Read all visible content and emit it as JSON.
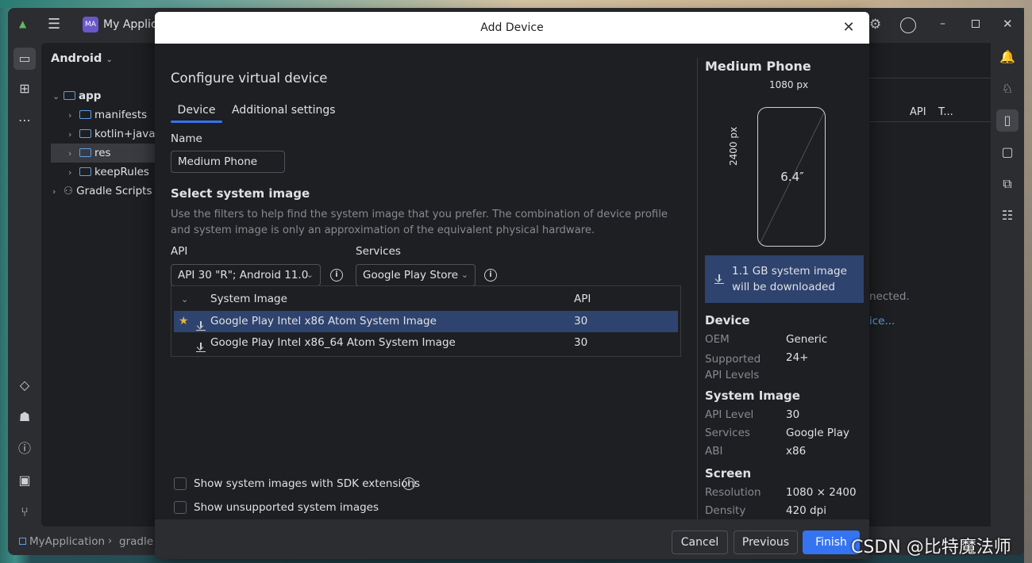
{
  "ide": {
    "app_badge": "MA",
    "app_title": "My Applica",
    "project_view": "Android",
    "tree": [
      {
        "label": "app",
        "level": 0,
        "expanded": true
      },
      {
        "label": "manifests",
        "level": 1
      },
      {
        "label": "kotlin+java",
        "level": 1
      },
      {
        "label": "res",
        "level": 1,
        "selected": true
      },
      {
        "label": "keepRules",
        "level": 1
      },
      {
        "label": "Gradle Scripts",
        "level": 0
      }
    ],
    "editor_header_cols": [
      "API",
      "T..."
    ],
    "editor_text_1": "nected.",
    "editor_text_2": "ice...",
    "breadcrumb": [
      "MyApplication",
      "gradle"
    ]
  },
  "dialog": {
    "title": "Add Device",
    "heading": "Configure virtual device",
    "tabs": [
      {
        "label": "Device",
        "active": true
      },
      {
        "label": "Additional settings",
        "active": false
      }
    ],
    "name_label": "Name",
    "name_value": "Medium Phone",
    "system_image_heading": "Select system image",
    "help_text": "Use the filters to help find the system image that you prefer. The combination of device profile and system image is only an approximation of the equivalent physical hardware.",
    "api_label": "API",
    "api_value": "API 30 \"R\"; Android 11.0",
    "services_label": "Services",
    "services_value": "Google Play Store",
    "table": {
      "columns": [
        "System Image",
        "API"
      ],
      "rows": [
        {
          "name": "Google Play Intel x86 Atom System Image",
          "api": "30",
          "selected": true,
          "starred": true
        },
        {
          "name": "Google Play Intel x86_64 Atom System Image",
          "api": "30",
          "selected": false,
          "starred": false
        }
      ]
    },
    "checkbox_sdk": "Show system images with SDK extensions",
    "checkbox_unsupported": "Show unsupported system images",
    "buttons": {
      "cancel": "Cancel",
      "previous": "Previous",
      "finish": "Finish"
    }
  },
  "side": {
    "title": "Medium Phone",
    "width_px": "1080 px",
    "height_px": "2400 px",
    "diagonal": "6.4″",
    "download_note": "1.1 GB system image will be downloaded",
    "device_heading": "Device",
    "oem_label": "OEM",
    "oem_value": "Generic",
    "api_levels_label": "Supported API Levels",
    "api_levels_value": "24+",
    "system_image_heading": "System Image",
    "api_level_label": "API Level",
    "api_level_value": "30",
    "services_label": "Services",
    "services_value": "Google Play",
    "abi_label": "ABI",
    "abi_value": "x86",
    "screen_heading": "Screen",
    "resolution_label": "Resolution",
    "resolution_value": "1080 × 2400",
    "density_label": "Density",
    "density_value": "420 dpi"
  },
  "watermark": "CSDN @比特魔法师",
  "colors": {
    "accent": "#3574f0",
    "selection": "#2e436e",
    "star": "#e8b33b",
    "folder": "#5e9ee8"
  }
}
